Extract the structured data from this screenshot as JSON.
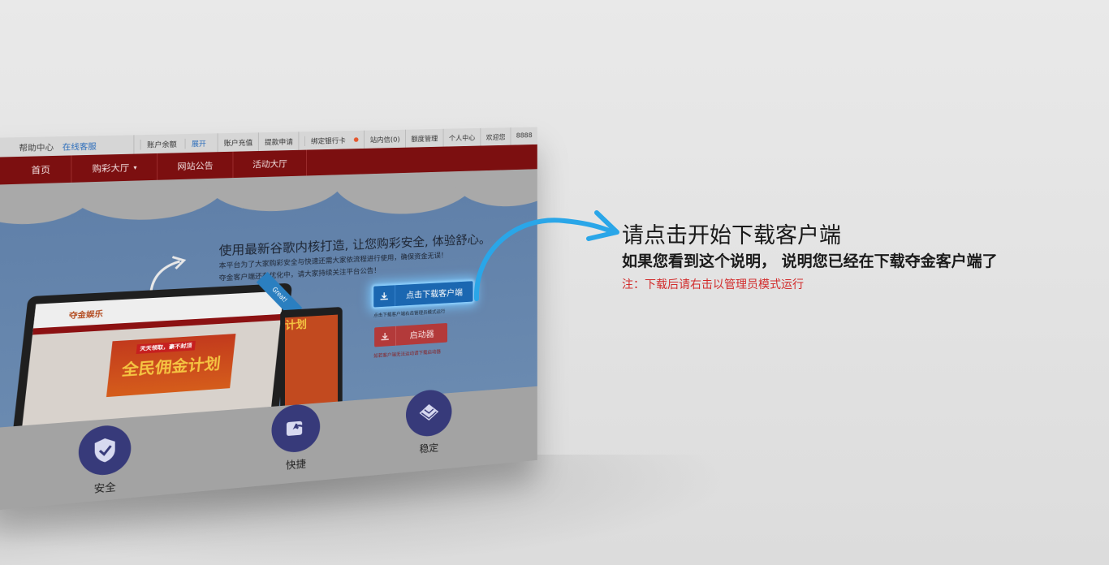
{
  "site": {
    "topbar": {
      "help": "帮助中心",
      "online_service": "在线客服",
      "balance_label": "账户余额",
      "balance_value": "展开",
      "items": [
        "账户充值",
        "提款申请",
        "绑定银行卡",
        "站内信(0)",
        "额度管理",
        "个人中心",
        "欢迎您",
        "8888"
      ]
    },
    "nav": [
      {
        "label": "首页"
      },
      {
        "label": "购彩大厅",
        "caret": "▾"
      },
      {
        "label": "网站公告"
      },
      {
        "label": "活动大厅"
      }
    ],
    "hero": {
      "title": "使用最新谷歌内核打造, 让您购彩安全, 体验舒心。",
      "sub1": "本平台为了大家购彩安全与快速还需大家依流程进行使用，确保资金无误！",
      "sub2": "夺金客户端还在优化中，请大家持续关注平台公告！"
    },
    "download_button": {
      "label": "点击下载客户端",
      "icon": "download-icon"
    },
    "download_note": "点击下载客户端右击管理员模式运行",
    "launcher_button": {
      "label": "启动器",
      "icon": "download-icon"
    },
    "launcher_note": "如若客户端无法运动请下载启动器",
    "monitor": {
      "logo": "夺金娱乐",
      "banner_small": "天天领取，豪不封顶",
      "banner_big": "全民佣金计划",
      "ribbon": "Great!",
      "tablet_text": "计划"
    },
    "features": [
      {
        "label": "安全",
        "icon": "shield-check-icon"
      },
      {
        "label": "快捷",
        "icon": "fast-arrow-icon"
      },
      {
        "label": "稳定",
        "icon": "pyramid-icon"
      }
    ]
  },
  "instructions": {
    "title": "请点击开始下载客户端",
    "subtitle": "如果您看到这个说明， 说明您已经在下载夺金客户端了",
    "note": "注：下载后请右击以管理员模式运行"
  },
  "colors": {
    "nav_red": "#7c0f10",
    "download_blue": "#1b67b1",
    "glow": "#78c8ff",
    "note_red": "#d22b2b",
    "feature_circle": "#373a7a",
    "arrow_cyan": "#2aa6e8"
  }
}
